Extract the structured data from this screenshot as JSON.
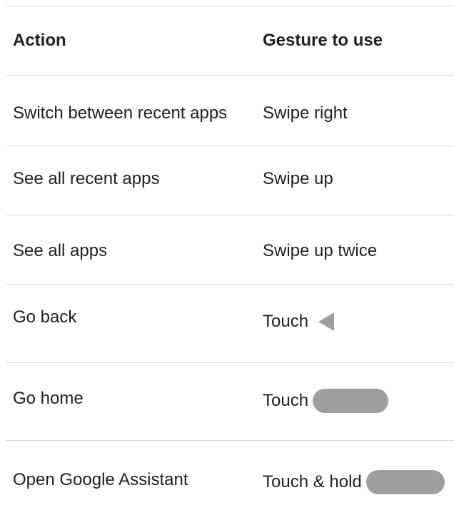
{
  "table": {
    "headers": {
      "action": "Action",
      "gesture": "Gesture to use"
    },
    "rows": [
      {
        "action": "Switch between recent apps",
        "gesture": "Swipe right"
      },
      {
        "action": "See all recent apps",
        "gesture": "Swipe up"
      },
      {
        "action": "See all apps",
        "gesture": "Swipe up twice"
      },
      {
        "action": "Go back",
        "gesture": "Touch",
        "icon": "back-triangle-icon"
      },
      {
        "action": "Go home",
        "gesture": "Touch",
        "icon": "home-pill-icon"
      },
      {
        "action": "Open Google Assistant",
        "gesture": "Touch & hold",
        "icon": "home-pill-icon"
      }
    ]
  },
  "colors": {
    "rule": "#dadce0",
    "text": "#202124",
    "icon": "#9e9e9e"
  }
}
